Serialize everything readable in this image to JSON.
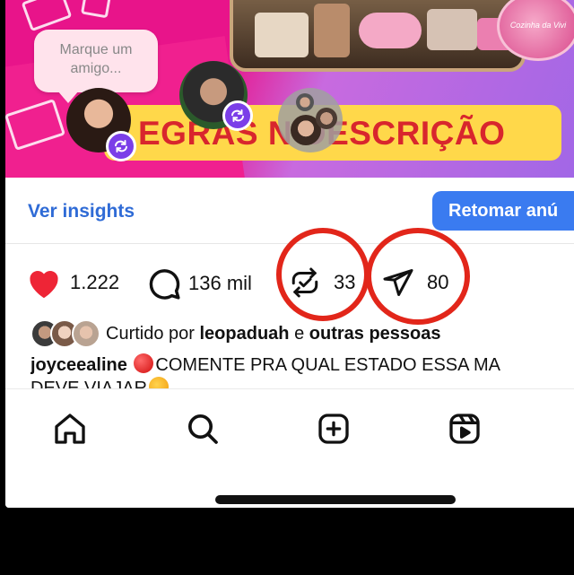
{
  "post_image": {
    "bubble_text": "Marque um amigo...",
    "headline": "EGRAS N DESCRIÇÃO",
    "plate_text": "Cozinha da Vivi"
  },
  "insights": {
    "link_label": "Ver insights",
    "button_label": "Retomar anú"
  },
  "actions": {
    "likes": "1.222",
    "comments": "136 mil",
    "reposts": "33",
    "shares": "80"
  },
  "liked_by": {
    "prefix": "Curtido por",
    "user": "leopaduah",
    "joiner": "e",
    "others": "outras pessoas"
  },
  "caption": {
    "username": "joyceealine",
    "text_line1": "COMENTE PRA QUAL ESTADO ESSA MA",
    "text_line2": "DEVE VIAJAR"
  },
  "tabbar": {
    "items": [
      "home-icon",
      "search-icon",
      "create-icon",
      "reels-icon"
    ]
  },
  "colors": {
    "accent_blue": "#3a7bf0",
    "like_red": "#ee2536",
    "annotation_circle": "#e2261a",
    "repost_purple": "#7b3ee8"
  }
}
